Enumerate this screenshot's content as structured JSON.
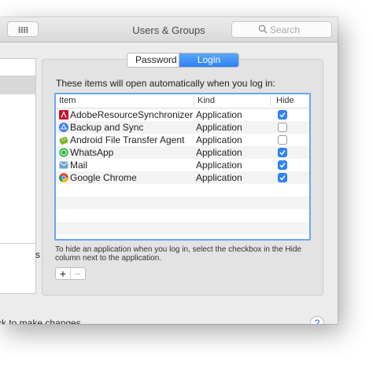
{
  "window": {
    "title": "Users & Groups",
    "search_placeholder": "Search"
  },
  "sidebar": {
    "bottom_item_partial": "s"
  },
  "tabs": [
    {
      "label": "Password",
      "active": false
    },
    {
      "label": "Login Items",
      "active": true
    }
  ],
  "login_items": {
    "intro": "These items will open automatically when you log in:",
    "columns": {
      "item": "Item",
      "kind": "Kind",
      "hide": "Hide"
    },
    "rows": [
      {
        "name": "AdobeResourceSynchronizer",
        "kind": "Application",
        "hide": true,
        "icon": "adobe-icon"
      },
      {
        "name": "Backup and Sync",
        "kind": "Application",
        "hide": false,
        "icon": "google-drive-icon"
      },
      {
        "name": "Android File Transfer Agent",
        "kind": "Application",
        "hide": false,
        "icon": "android-icon"
      },
      {
        "name": "WhatsApp",
        "kind": "Application",
        "hide": true,
        "icon": "whatsapp-icon"
      },
      {
        "name": "Mail",
        "kind": "Application",
        "hide": true,
        "icon": "mail-icon"
      },
      {
        "name": "Google Chrome",
        "kind": "Application",
        "hide": true,
        "icon": "chrome-icon"
      }
    ],
    "help": "To hide an application when you log in, select the checkbox in the Hide column next to the application.",
    "add_label": "+",
    "remove_label": "−"
  },
  "footer": {
    "lock_message": "ck to make changes.",
    "help_label": "?"
  },
  "colors": {
    "accent": "#2f86f6",
    "focus_ring": "#6aa6ef"
  }
}
